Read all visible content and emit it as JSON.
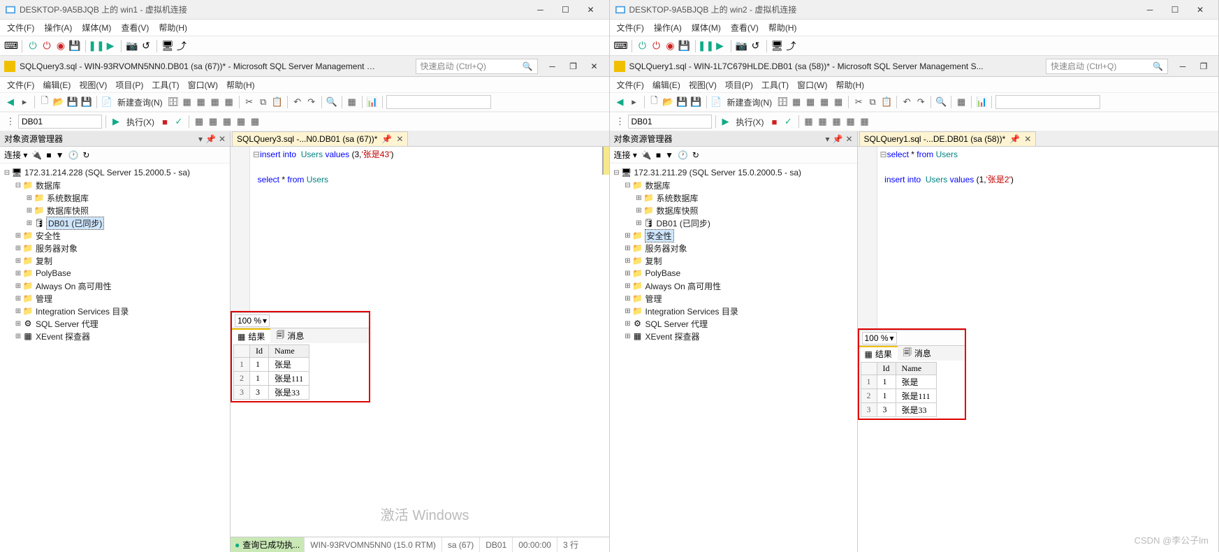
{
  "left": {
    "vm_title": "DESKTOP-9A5BJQB 上的 win1 - 虚拟机连接",
    "vm_menu": [
      "文件(F)",
      "操作(A)",
      "媒体(M)",
      "查看(V)",
      "帮助(H)"
    ],
    "ssms_title": "SQLQuery3.sql - WIN-93RVOMN5NN0.DB01 (sa (67))* - Microsoft SQL Server Management St...",
    "quick_launch": "快速启动 (Ctrl+Q)",
    "ssms_menu": [
      "文件(F)",
      "编辑(E)",
      "视图(V)",
      "项目(P)",
      "工具(T)",
      "窗口(W)",
      "帮助(H)"
    ],
    "new_query": "新建查询(N)",
    "db_combo": "DB01",
    "execute": "执行(X)",
    "oe_title": "对象资源管理器",
    "connect_label": "连接 ▾",
    "server": "172.31.214.228 (SQL Server 15.2000.5 - sa)",
    "tree": {
      "databases": "数据库",
      "sysdb": "系统数据库",
      "snapshot": "数据库快照",
      "db01": "DB01 (已同步)",
      "security": "安全性",
      "serverobj": "服务器对象",
      "replication": "复制",
      "polybase": "PolyBase",
      "alwayson": "Always On 高可用性",
      "management": "管理",
      "isc": "Integration Services 目录",
      "agent": "SQL Server 代理",
      "xevent": "XEvent 探查器"
    },
    "tab": "SQLQuery3.sql -...N0.DB01 (sa (67))*",
    "sql_line1_pre": "insert into",
    "sql_line1_tbl": "Users",
    "sql_line1_kw2": "values",
    "sql_line1_args": "(3,",
    "sql_line1_str": "'张是43'",
    "sql_line1_end": ")",
    "sql_line2_sel": "select",
    "sql_line2_star": " * ",
    "sql_line2_from": "from",
    "sql_line2_tbl": "Users",
    "zoom": "100 %",
    "tab_results": "结果",
    "tab_messages": "消息",
    "cols": {
      "id": "Id",
      "name": "Name"
    },
    "rows": [
      {
        "n": "1",
        "id": "1",
        "name": "张是"
      },
      {
        "n": "2",
        "id": "1",
        "name": "张是111"
      },
      {
        "n": "3",
        "id": "3",
        "name": "张是33"
      }
    ],
    "status_ok": "查询已成功执...",
    "status_server": "WIN-93RVOMN5NN0 (15.0 RTM)",
    "status_user": "sa (67)",
    "status_db": "DB01",
    "status_time": "00:00:00",
    "status_rows": "3 行",
    "watermark": "激活 Windows"
  },
  "right": {
    "vm_title": "DESKTOP-9A5BJQB 上的 win2 - 虚拟机连接",
    "vm_menu": [
      "文件(F)",
      "操作(A)",
      "媒体(M)",
      "查看(V)",
      "帮助(H)"
    ],
    "ssms_title": "SQLQuery1.sql - WIN-1L7C679HLDE.DB01 (sa (58))* - Microsoft SQL Server Management S...",
    "quick_launch": "快速启动 (Ctrl+Q)",
    "ssms_menu": [
      "文件(F)",
      "编辑(E)",
      "视图(V)",
      "项目(P)",
      "工具(T)",
      "窗口(W)",
      "帮助(H)"
    ],
    "new_query": "新建查询(N)",
    "db_combo": "DB01",
    "execute": "执行(X)",
    "oe_title": "对象资源管理器",
    "connect_label": "连接 ▾",
    "server": "172.31.211.29 (SQL Server 15.0.2000.5 - sa)",
    "tree": {
      "databases": "数据库",
      "sysdb": "系统数据库",
      "snapshot": "数据库快照",
      "db01": "DB01 (已同步)",
      "security": "安全性",
      "serverobj": "服务器对象",
      "replication": "复制",
      "polybase": "PolyBase",
      "alwayson": "Always On 高可用性",
      "management": "管理",
      "isc": "Integration Services 目录",
      "agent": "SQL Server 代理",
      "xevent": "XEvent 探查器"
    },
    "tab": "SQLQuery1.sql -...DE.DB01 (sa (58))*",
    "sql_line1_sel": "select",
    "sql_line1_star": " * ",
    "sql_line1_from": "from",
    "sql_line1_tbl": "Users",
    "sql_line2_ins": "insert into",
    "sql_line2_tbl": "Users",
    "sql_line2_val": "values",
    "sql_line2_args": "(1,",
    "sql_line2_str": "'张是2'",
    "sql_line2_end": ")",
    "zoom": "100 %",
    "tab_results": "结果",
    "tab_messages": "消息",
    "cols": {
      "id": "Id",
      "name": "Name"
    },
    "rows": [
      {
        "n": "1",
        "id": "1",
        "name": "张是"
      },
      {
        "n": "2",
        "id": "1",
        "name": "张是111"
      },
      {
        "n": "3",
        "id": "3",
        "name": "张是33"
      }
    ]
  },
  "csdn": "CSDN @李公子lm"
}
